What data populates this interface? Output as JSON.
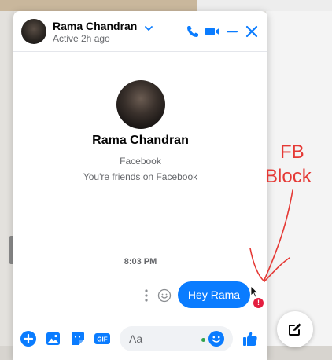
{
  "chat_header": {
    "name": "Rama Chandran",
    "status": "Active 2h ago",
    "icons": [
      "chevron-down-icon",
      "phone-icon",
      "video-icon",
      "minimize-icon",
      "close-icon"
    ]
  },
  "profile": {
    "name": "Rama Chandran",
    "platform": "Facebook",
    "relationship": "You're friends on Facebook"
  },
  "messages": [
    {
      "time": "8:03 PM",
      "text": "Hey Rama",
      "from_me": true,
      "failed": true,
      "error_glyph": "!"
    }
  ],
  "composer": {
    "placeholder": "Aa",
    "gif_label": "GIF",
    "icons": [
      "plus-icon",
      "photo-icon",
      "sticker-icon",
      "gif-icon",
      "emoji-icon",
      "thumbs-up-icon"
    ]
  },
  "annotation": {
    "line1": "FB",
    "line2": "Block",
    "color": "#e53935"
  },
  "colors": {
    "accent": "#0a7cff",
    "error": "#e41e3f",
    "online": "#31a24c"
  }
}
